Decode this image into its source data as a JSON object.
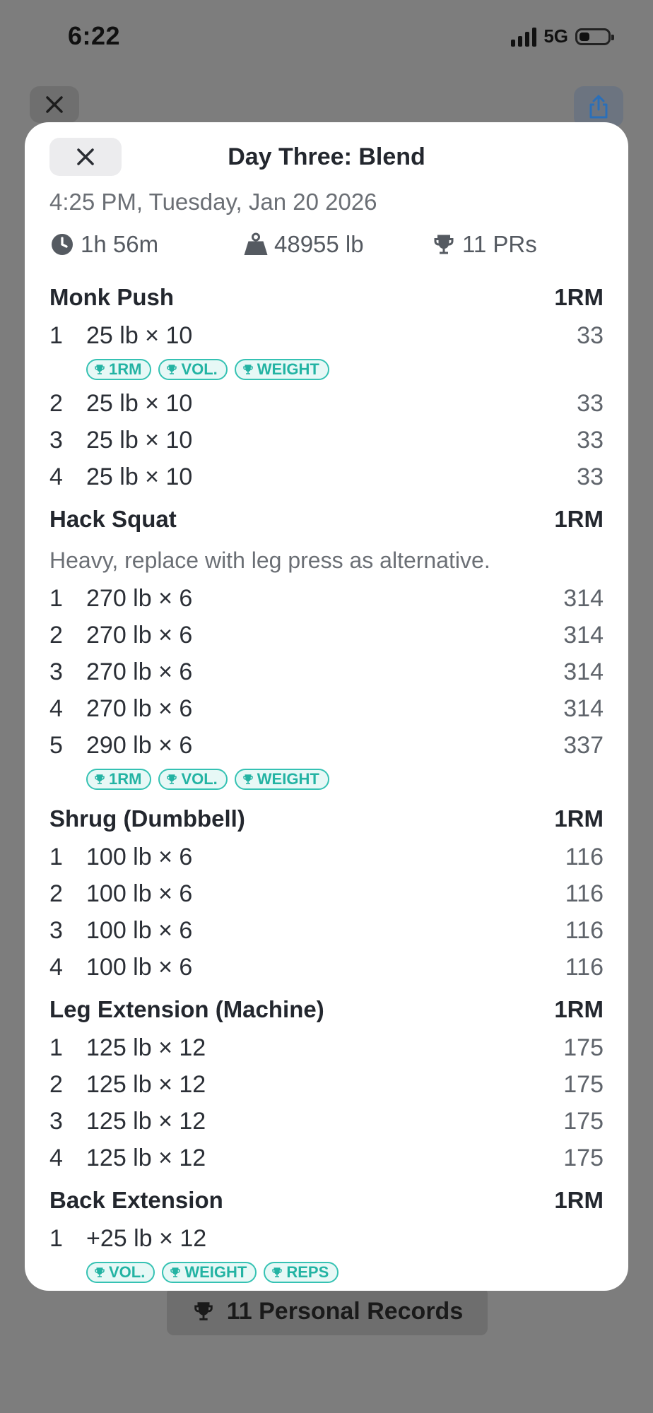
{
  "status_bar": {
    "time": "6:22",
    "network": "5G"
  },
  "background": {
    "records_label": "11 Personal Records"
  },
  "modal": {
    "title": "Day Three: Blend",
    "datetime": "4:25 PM, Tuesday, Jan 20 2026",
    "stats": {
      "duration": "1h 56m",
      "volume": "48955 lb",
      "prs": "11 PRs"
    }
  },
  "exercises": [
    {
      "name": "Monk Push",
      "unit": "1RM",
      "note": "",
      "sets": [
        {
          "no": "1",
          "value": "25 lb × 10",
          "rm": "33",
          "badges": [
            "1RM",
            "VOL.",
            "WEIGHT"
          ]
        },
        {
          "no": "2",
          "value": "25 lb × 10",
          "rm": "33",
          "badges": []
        },
        {
          "no": "3",
          "value": "25 lb × 10",
          "rm": "33",
          "badges": []
        },
        {
          "no": "4",
          "value": "25 lb × 10",
          "rm": "33",
          "badges": []
        }
      ]
    },
    {
      "name": "Hack Squat",
      "unit": "1RM",
      "note": "Heavy, replace with leg press as alternative.",
      "sets": [
        {
          "no": "1",
          "value": "270 lb × 6",
          "rm": "314",
          "badges": []
        },
        {
          "no": "2",
          "value": "270 lb × 6",
          "rm": "314",
          "badges": []
        },
        {
          "no": "3",
          "value": "270 lb × 6",
          "rm": "314",
          "badges": []
        },
        {
          "no": "4",
          "value": "270 lb × 6",
          "rm": "314",
          "badges": []
        },
        {
          "no": "5",
          "value": "290 lb × 6",
          "rm": "337",
          "badges": [
            "1RM",
            "VOL.",
            "WEIGHT"
          ]
        }
      ]
    },
    {
      "name": "Shrug (Dumbbell)",
      "unit": "1RM",
      "note": "",
      "sets": [
        {
          "no": "1",
          "value": "100 lb × 6",
          "rm": "116",
          "badges": []
        },
        {
          "no": "2",
          "value": "100 lb × 6",
          "rm": "116",
          "badges": []
        },
        {
          "no": "3",
          "value": "100 lb × 6",
          "rm": "116",
          "badges": []
        },
        {
          "no": "4",
          "value": "100 lb × 6",
          "rm": "116",
          "badges": []
        }
      ]
    },
    {
      "name": "Leg Extension (Machine)",
      "unit": "1RM",
      "note": "",
      "sets": [
        {
          "no": "1",
          "value": "125 lb × 12",
          "rm": "175",
          "badges": []
        },
        {
          "no": "2",
          "value": "125 lb × 12",
          "rm": "175",
          "badges": []
        },
        {
          "no": "3",
          "value": "125 lb × 12",
          "rm": "175",
          "badges": []
        },
        {
          "no": "4",
          "value": "125 lb × 12",
          "rm": "175",
          "badges": []
        }
      ]
    },
    {
      "name": "Back Extension",
      "unit": "1RM",
      "note": "",
      "sets": [
        {
          "no": "1",
          "value": "+25 lb × 12",
          "rm": "",
          "badges": [
            "VOL.",
            "WEIGHT",
            "REPS"
          ]
        }
      ]
    }
  ],
  "colors": {
    "accent": "#35c2b3",
    "share_icon": "#2b7fd6"
  }
}
